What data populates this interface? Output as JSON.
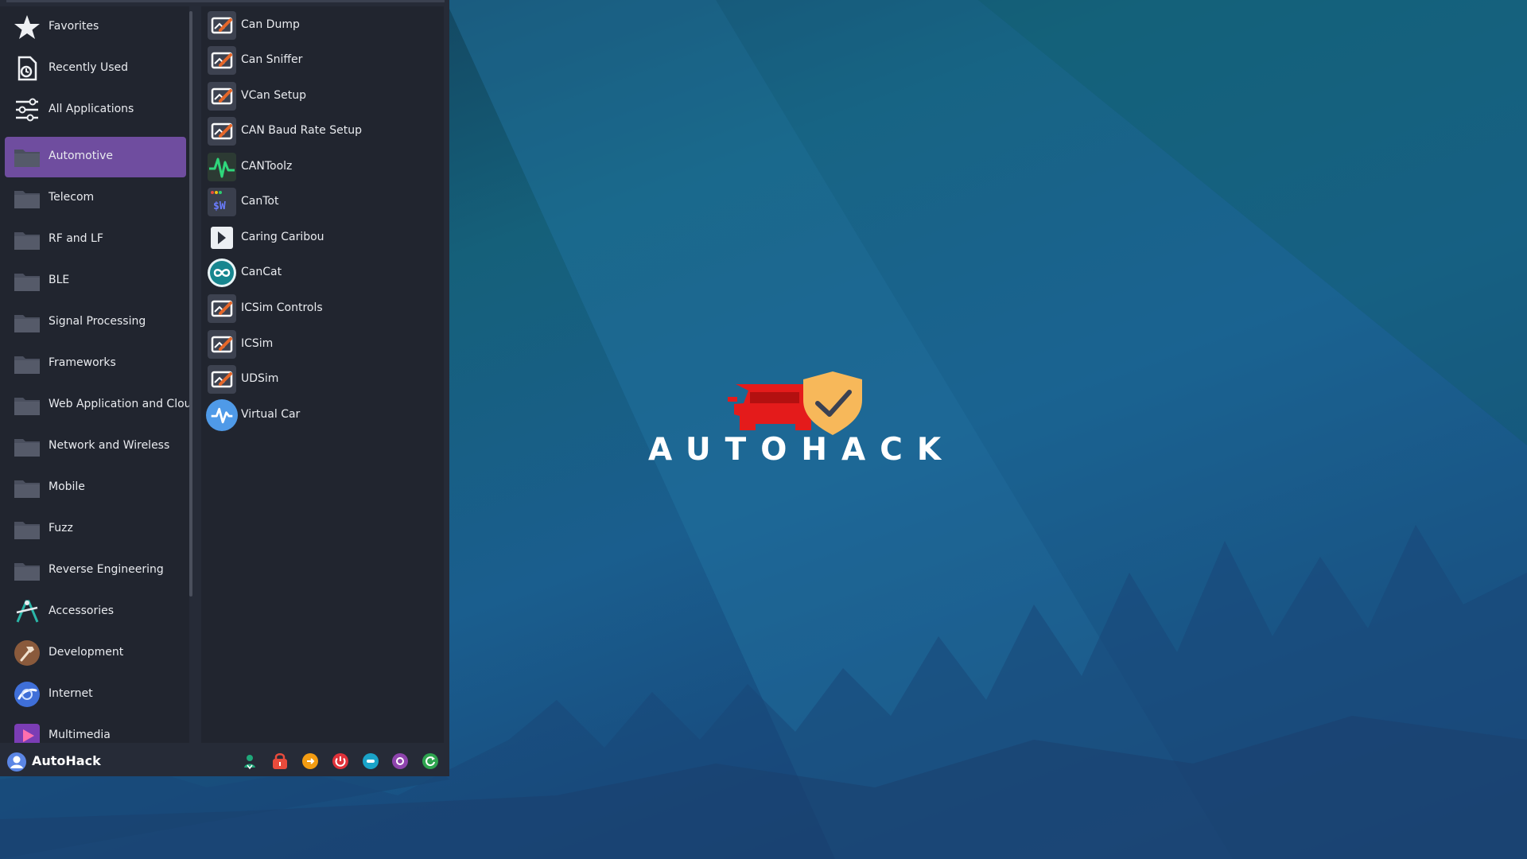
{
  "desktop": {
    "logo_text": "AUTOHACK",
    "colors": {
      "brand_red": "#e41b1b",
      "shield": "#f7b85a",
      "wallpaper_top": "#15607a",
      "wallpaper_bottom": "#1c3568"
    }
  },
  "menu": {
    "colors": {
      "panel": "#262b37",
      "highlight": "#6f4d9f",
      "text": "#e9ebef"
    },
    "categories": [
      {
        "label": "Favorites",
        "icon": "star-icon"
      },
      {
        "label": "Recently Used",
        "icon": "recent-document-icon"
      },
      {
        "label": "All Applications",
        "icon": "sliders-icon"
      },
      {
        "label": "Automotive",
        "icon": "folder-icon",
        "selected": true
      },
      {
        "label": "Telecom",
        "icon": "folder-icon"
      },
      {
        "label": "RF and LF",
        "icon": "folder-icon"
      },
      {
        "label": "BLE",
        "icon": "folder-icon"
      },
      {
        "label": "Signal Processing",
        "icon": "folder-icon"
      },
      {
        "label": "Frameworks",
        "icon": "folder-icon"
      },
      {
        "label": "Web Application and Cloud",
        "icon": "folder-icon"
      },
      {
        "label": "Network and Wireless",
        "icon": "folder-icon"
      },
      {
        "label": "Mobile",
        "icon": "folder-icon"
      },
      {
        "label": "Fuzz",
        "icon": "folder-icon"
      },
      {
        "label": "Reverse Engineering",
        "icon": "folder-icon"
      },
      {
        "label": "Accessories",
        "icon": "accessories-icon"
      },
      {
        "label": "Development",
        "icon": "hammer-icon"
      },
      {
        "label": "Internet",
        "icon": "globe-icon"
      },
      {
        "label": "Multimedia",
        "icon": "multimedia-icon"
      }
    ],
    "apps": [
      {
        "label": "Can Dump",
        "icon": "terminal-icon"
      },
      {
        "label": "Can Sniffer",
        "icon": "terminal-icon"
      },
      {
        "label": "VCan Setup",
        "icon": "terminal-icon"
      },
      {
        "label": "CAN Baud Rate Setup",
        "icon": "terminal-icon"
      },
      {
        "label": "CANToolz",
        "icon": "waveform-icon"
      },
      {
        "label": "CanTot",
        "icon": "shell-icon"
      },
      {
        "label": "Caring Caribou",
        "icon": "prompt-icon"
      },
      {
        "label": "CanCat",
        "icon": "infinity-icon"
      },
      {
        "label": "ICSim Controls",
        "icon": "terminal-icon"
      },
      {
        "label": "ICSim",
        "icon": "terminal-icon"
      },
      {
        "label": "UDSim",
        "icon": "terminal-icon"
      },
      {
        "label": "Virtual Car",
        "icon": "pulse-icon"
      }
    ],
    "user": {
      "name": "AutoHack",
      "icon": "user-icon"
    },
    "actions": [
      {
        "name": "switch-user",
        "icon": "switch-user-icon",
        "color": "#1fa87a"
      },
      {
        "name": "lock",
        "icon": "lock-icon",
        "color": "#e84b3c"
      },
      {
        "name": "logout",
        "icon": "logout-icon",
        "color": "#f39c12"
      },
      {
        "name": "shutdown",
        "icon": "power-icon",
        "color": "#e0323a"
      },
      {
        "name": "suspend",
        "icon": "suspend-icon",
        "color": "#1aa3c8"
      },
      {
        "name": "hibernate",
        "icon": "hibernate-icon",
        "color": "#8e44ad"
      },
      {
        "name": "restart",
        "icon": "restart-icon",
        "color": "#2ea44f"
      }
    ]
  }
}
